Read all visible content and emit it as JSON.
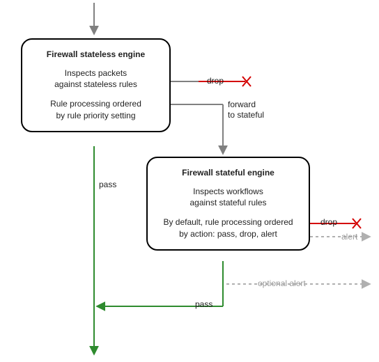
{
  "diagram": {
    "boxes": {
      "stateless": {
        "title": "Firewall stateless engine",
        "p1": "Inspects packets\nagainst stateless rules",
        "p2": "Rule processing ordered\nby rule priority setting"
      },
      "stateful": {
        "title": "Firewall stateful engine",
        "p1": "Inspects workflows\nagainst stateful rules",
        "p2": "By default, rule processing ordered\nby action: pass, drop, alert"
      }
    },
    "labels": {
      "drop1": "drop",
      "forward1": "forward",
      "forward2": "to stateful",
      "pass1": "pass",
      "drop2": "drop",
      "alert": "alert",
      "optional_alert": "optional alert",
      "pass2": "pass"
    },
    "colors": {
      "gray": "#808080",
      "green": "#2e8b2e",
      "red": "#d40000",
      "lightgray": "#b0b0b0"
    }
  }
}
